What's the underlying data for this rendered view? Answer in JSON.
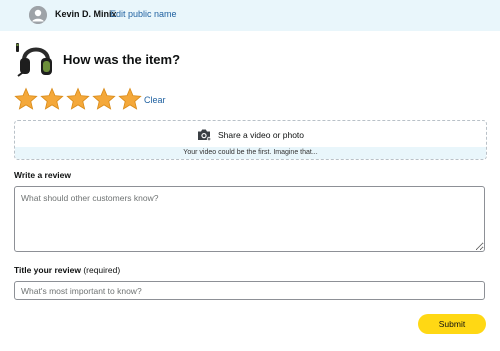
{
  "user": {
    "name": "Kevin D. Minix",
    "edit_link": "Edit public name"
  },
  "product": {
    "image_icon": "headset-image",
    "question": "How was the item?"
  },
  "rating": {
    "stars": 5,
    "max": 5,
    "star_color": "#f4a83a",
    "clear_label": "Clear"
  },
  "media": {
    "icon": "camera-icon",
    "share_label": "Share a video or photo",
    "hint": "Your video could be the first. Imagine that..."
  },
  "review": {
    "label": "Write a review",
    "placeholder": "What should other customers know?"
  },
  "title": {
    "label": "Title your review",
    "required_note": "(required)",
    "placeholder": "What's most important to know?"
  },
  "submit": {
    "label": "Submit",
    "color": "#ffd814"
  },
  "colors": {
    "header_bg": "#e9f6fb",
    "link": "#2162a1"
  }
}
